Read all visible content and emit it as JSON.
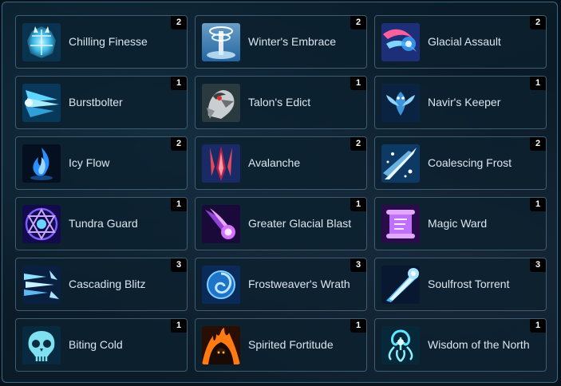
{
  "colors": {
    "background": "#07131c",
    "tile_background": "#0c202e",
    "tile_border": "#3f5d70",
    "text": "#dbe6ee",
    "badge_background": "#000000",
    "badge_text": "#ffffff"
  },
  "items": [
    {
      "name": "Chilling Finesse",
      "count": "2",
      "icon": "ice-armor-icon"
    },
    {
      "name": "Winter's Embrace",
      "count": "2",
      "icon": "frost-vortex-icon"
    },
    {
      "name": "Glacial Assault",
      "count": "2",
      "icon": "pink-frost-swirl-icon"
    },
    {
      "name": "Burstbolter",
      "count": "1",
      "icon": "ice-shards-burst-icon"
    },
    {
      "name": "Talon's Edict",
      "count": "1",
      "icon": "hawk-head-icon"
    },
    {
      "name": "Navir's Keeper",
      "count": "1",
      "icon": "frost-spirit-icon"
    },
    {
      "name": "Icy Flow",
      "count": "2",
      "icon": "blue-flame-icon"
    },
    {
      "name": "Avalanche",
      "count": "2",
      "icon": "falling-ice-icon"
    },
    {
      "name": "Coalescing Frost",
      "count": "2",
      "icon": "frost-streak-icon"
    },
    {
      "name": "Tundra Guard",
      "count": "1",
      "icon": "arcane-hexagram-icon"
    },
    {
      "name": "Greater Glacial Blast",
      "count": "1",
      "icon": "violet-comet-icon"
    },
    {
      "name": "Magic Ward",
      "count": "1",
      "icon": "magic-scroll-icon"
    },
    {
      "name": "Cascading Blitz",
      "count": "3",
      "icon": "ice-spikes-icon"
    },
    {
      "name": "Frostweaver's Wrath",
      "count": "3",
      "icon": "frost-orb-icon"
    },
    {
      "name": "Soulfrost Torrent",
      "count": "3",
      "icon": "frost-beam-icon"
    },
    {
      "name": "Biting Cold",
      "count": "1",
      "icon": "ice-skull-icon"
    },
    {
      "name": "Spirited Fortitude",
      "count": "1",
      "icon": "fire-hooded-figure-icon"
    },
    {
      "name": "Wisdom of the North",
      "count": "1",
      "icon": "frost-tentacle-icon"
    }
  ]
}
